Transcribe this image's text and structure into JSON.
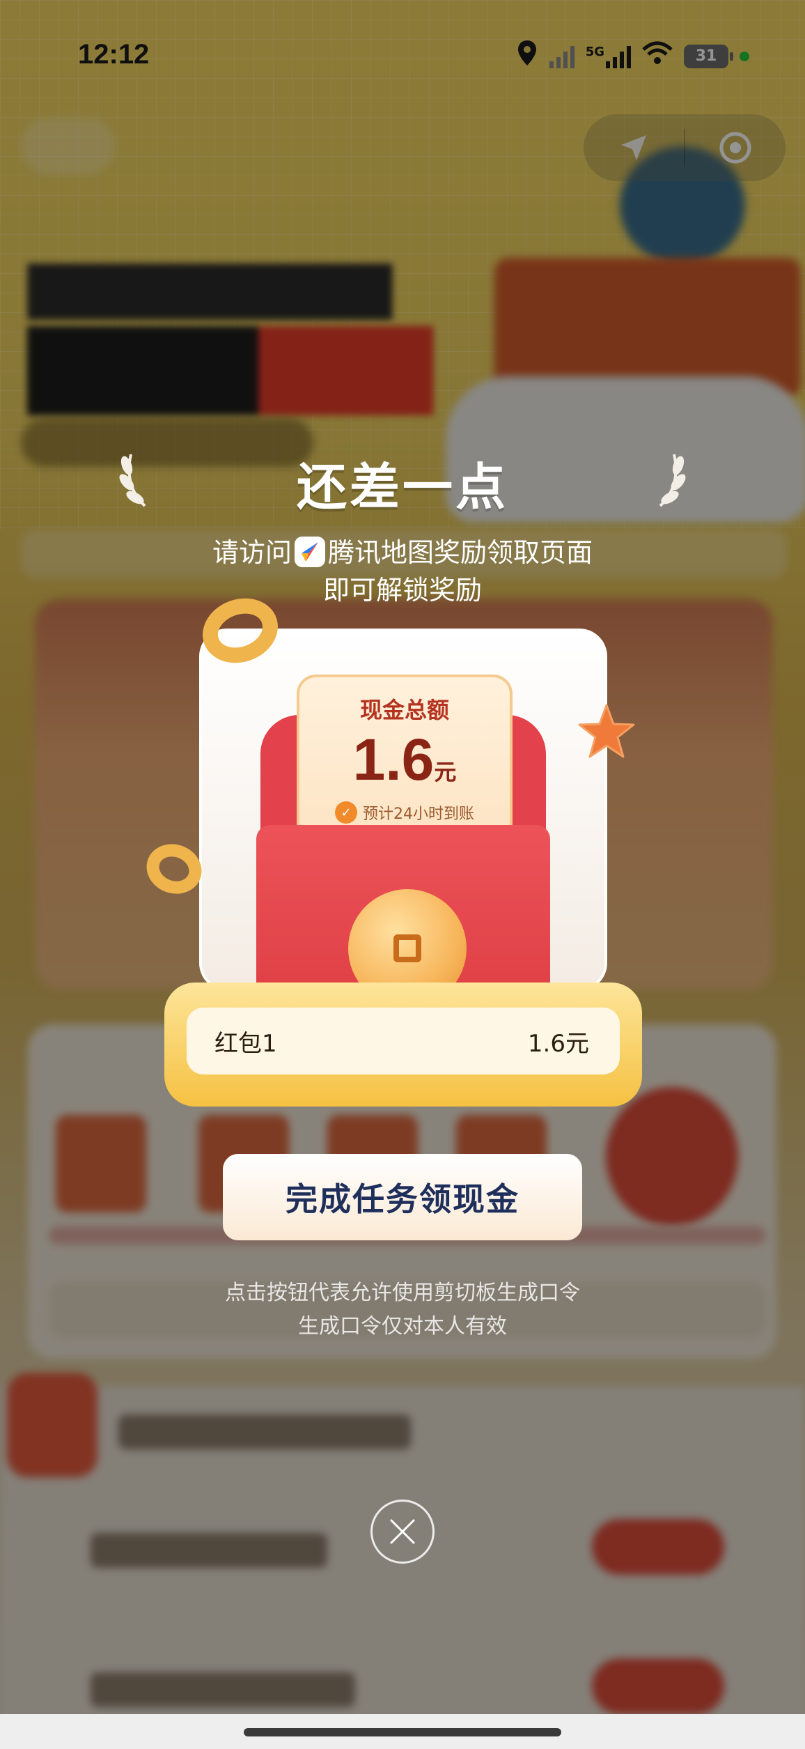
{
  "status_bar": {
    "time": "12:12",
    "network": "5G",
    "battery": "31",
    "icons": [
      "location-icon",
      "no-signal-icon",
      "signal-5g-icon",
      "wifi-icon",
      "battery-icon",
      "active-dot-icon"
    ]
  },
  "mini_program_capsule": {
    "icons": [
      "location-arrow-icon",
      "target-icon"
    ]
  },
  "modal": {
    "title": "还差一点",
    "subtitle_prefix": "请访问",
    "subtitle_app": "腾讯地图奖励领取页面",
    "subtitle_line2": "即可解锁奖励",
    "card": {
      "label": "现金总额",
      "amount": "1.6",
      "unit": "元",
      "eta": "预计24小时到账"
    },
    "row": {
      "name": "红包1",
      "value": "1.6元"
    },
    "primary_button": "完成任务领现金",
    "hint_line1": "点击按钮代表允许使用剪切板生成口令",
    "hint_line2": "生成口令仅对本人有效"
  },
  "colors": {
    "accent_red": "#e3414b",
    "gold": "#f5c142",
    "button_text": "#1f2f5c"
  }
}
